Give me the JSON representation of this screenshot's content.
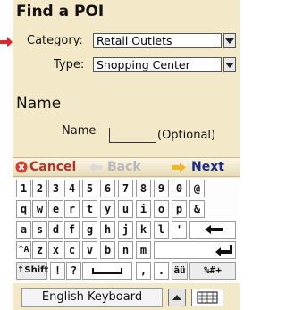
{
  "title": "Find a POI",
  "category": {
    "label": "Category:",
    "value": "Retail Outlets"
  },
  "type": {
    "label": "Type:",
    "value": "Shopping Center"
  },
  "name_section": {
    "heading": "Name",
    "label": "Name",
    "optional": "(Optional)"
  },
  "nav": {
    "cancel": "Cancel",
    "back": "Back",
    "next": "Next"
  },
  "keyboard": {
    "row1": [
      "1",
      "2",
      "3",
      "4",
      "5",
      "6",
      "7",
      "8",
      "9",
      "0",
      "@"
    ],
    "row2": [
      "q",
      "w",
      "e",
      "r",
      "t",
      "y",
      "u",
      "i",
      "o",
      "p",
      "&"
    ],
    "row3": [
      "a",
      "s",
      "d",
      "f",
      "g",
      "h",
      "j",
      "k",
      "l",
      "'"
    ],
    "row4": [
      "^A",
      "z",
      "x",
      "c",
      "v",
      "b",
      "n",
      "m"
    ],
    "row5": {
      "shift": "Shift",
      "bang": "!",
      "question": "?",
      "comma": ",",
      "period": ".",
      "accents": "äü",
      "symbols": "%#+"
    },
    "name": "English Keyboard"
  },
  "colors": {
    "panel": "#f3e9c8",
    "arrow": "#e3262e",
    "cancel_icon": "#d93a2b",
    "next_arrow": "#f0b528"
  }
}
